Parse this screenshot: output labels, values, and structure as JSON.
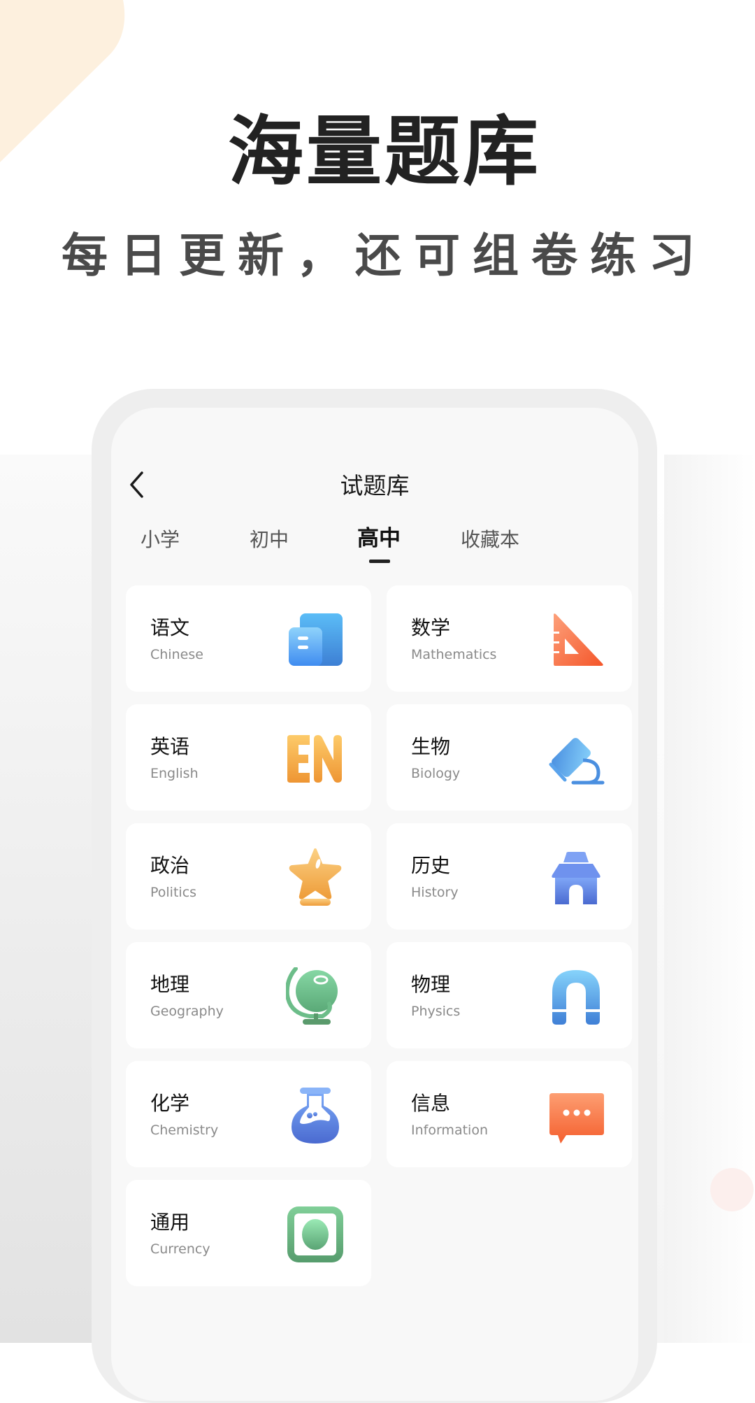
{
  "hero": {
    "title": "海量题库",
    "subtitle": "每日更新，还可组卷练习"
  },
  "colors": {
    "peach_blob": "#fdf0de",
    "pink_dot": "#fcefed",
    "title_text": "#222222",
    "subtitle_text": "#4a4a4a"
  },
  "phone": {
    "nav": {
      "back_icon": "chevron-left-icon",
      "title": "试题库"
    },
    "tabs": [
      {
        "label": "小学",
        "active": false
      },
      {
        "label": "初中",
        "active": false
      },
      {
        "label": "高中",
        "active": true
      },
      {
        "label": "收藏本",
        "active": false
      }
    ],
    "subjects": [
      {
        "zh": "语文",
        "en": "Chinese",
        "icon": "document-icon"
      },
      {
        "zh": "数学",
        "en": "Mathematics",
        "icon": "triangle-ruler-icon"
      },
      {
        "zh": "英语",
        "en": "English",
        "icon": "en-letters-icon"
      },
      {
        "zh": "生物",
        "en": "Biology",
        "icon": "microscope-icon"
      },
      {
        "zh": "政治",
        "en": "Politics",
        "icon": "star-trophy-icon"
      },
      {
        "zh": "历史",
        "en": "History",
        "icon": "temple-icon"
      },
      {
        "zh": "地理",
        "en": "Geography",
        "icon": "globe-icon"
      },
      {
        "zh": "物理",
        "en": "Physics",
        "icon": "magnet-icon"
      },
      {
        "zh": "化学",
        "en": "Chemistry",
        "icon": "flask-icon"
      },
      {
        "zh": "信息",
        "en": "Information",
        "icon": "chat-bubble-icon"
      },
      {
        "zh": "通用",
        "en": "Currency",
        "icon": "record-button-icon"
      }
    ]
  }
}
